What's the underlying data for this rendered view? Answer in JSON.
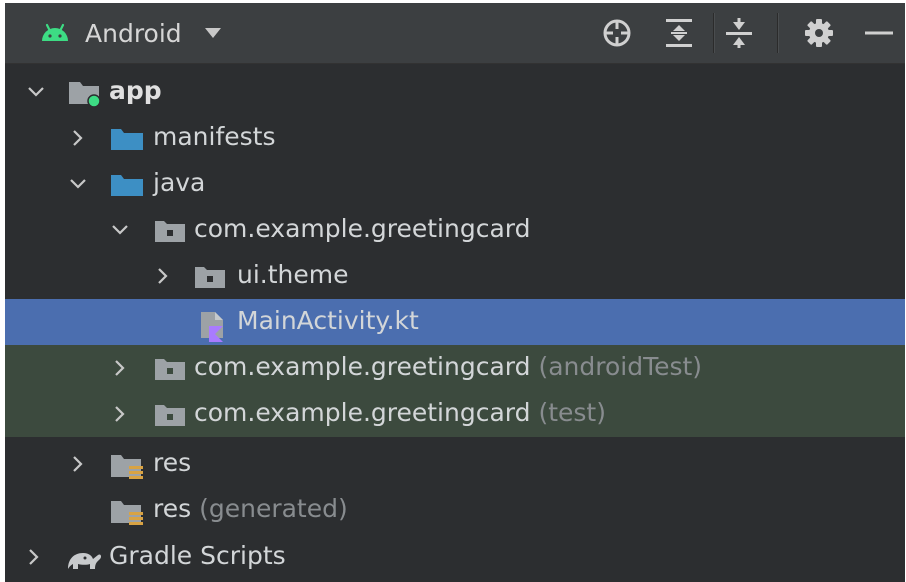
{
  "toolbar": {
    "view_label": "Android",
    "icons": [
      "locate-icon",
      "expand-all-icon",
      "collapse-all-icon",
      "gear-icon",
      "hide-icon"
    ]
  },
  "tree": {
    "rows": [
      {
        "label": "app",
        "suffix": "",
        "state": "expanded"
      },
      {
        "label": "manifests",
        "suffix": "",
        "state": "collapsed"
      },
      {
        "label": "java",
        "suffix": "",
        "state": "expanded"
      },
      {
        "label": "com.example.greetingcard",
        "suffix": "",
        "state": "expanded"
      },
      {
        "label": "ui.theme",
        "suffix": "",
        "state": "collapsed"
      },
      {
        "label": "MainActivity.kt",
        "suffix": "",
        "state": "selected"
      },
      {
        "label": "com.example.greetingcard",
        "suffix": "(androidTest)",
        "state": "collapsed"
      },
      {
        "label": "com.example.greetingcard",
        "suffix": "(test)",
        "state": "collapsed"
      },
      {
        "label": "res",
        "suffix": "",
        "state": "collapsed"
      },
      {
        "label": "res",
        "suffix": "(generated)",
        "state": "leaf"
      },
      {
        "label": "Gradle Scripts",
        "suffix": "",
        "state": "collapsed"
      }
    ]
  },
  "colors": {
    "panel_bg": "#2c2e30",
    "toolbar_bg": "#3c3f41",
    "selection": "#4b6eaf",
    "test_highlight": "#3c4a3e",
    "android_green": "#3ddc84",
    "folder_blue": "#3d8fc4",
    "kotlin_purple": "#a97bff"
  }
}
